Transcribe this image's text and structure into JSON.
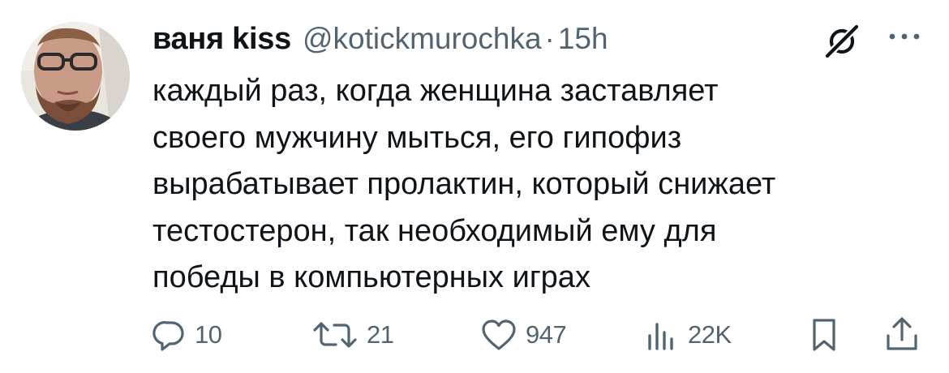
{
  "tweet": {
    "author_name": "ваня kiss",
    "handle": "@kotickmurochka",
    "separator": "·",
    "time": "15h",
    "text": "каждый раз, когда женщина заставляет своего мужчину мыться, его гипофиз вырабатывает пролактин, который снижает тестостерон, так необходимый ему для победы в компьютерных играх",
    "text_lines": [
      "каждый раз, когда женщина заставляет",
      "своего мужчину мыться, его гипофиз",
      "вырабатывает пролактин, который снижает",
      "тестостерон, так необходимый ему для",
      "победы в компьютерных играх"
    ]
  },
  "actions": {
    "reply_count": "10",
    "retweet_count": "21",
    "like_count": "947",
    "views_count": "22K"
  },
  "icons": {
    "avatar": "avatar",
    "grok": "grok-icon",
    "more": "more-icon",
    "reply": "reply-icon",
    "retweet": "retweet-icon",
    "like": "heart-icon",
    "views": "views-icon",
    "bookmark": "bookmark-icon",
    "share": "share-icon"
  },
  "colors": {
    "text": "#0f1419",
    "secondary": "#536471",
    "background": "#ffffff"
  }
}
